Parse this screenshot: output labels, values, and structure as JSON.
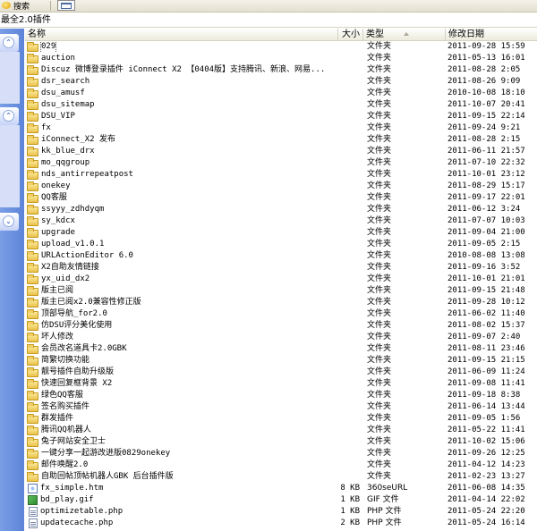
{
  "toolbar": {
    "search_label": "搜索",
    "view_icon": "view-grid-icon"
  },
  "address": {
    "path": "最全2.0插件"
  },
  "columns": {
    "name": "名称",
    "size": "大小",
    "type": "类型",
    "date": "修改日期"
  },
  "files": [
    {
      "name": "029",
      "size": "",
      "type": "文件夹",
      "date": "2011-09-28 15:59",
      "icon": "folder-icon"
    },
    {
      "name": "auction",
      "size": "",
      "type": "文件夹",
      "date": "2011-05-13 16:01",
      "icon": "folder-icon"
    },
    {
      "name": "Discuz 微博登录插件 iConnect X2 【0404版】支持腾讯、新浪、网易...",
      "size": "",
      "type": "文件夹",
      "date": "2011-08-28 2:05",
      "icon": "folder-icon"
    },
    {
      "name": "dsr_search",
      "size": "",
      "type": "文件夹",
      "date": "2011-08-26 9:09",
      "icon": "folder-icon"
    },
    {
      "name": "dsu_amusf",
      "size": "",
      "type": "文件夹",
      "date": "2010-10-08 18:10",
      "icon": "folder-icon"
    },
    {
      "name": "dsu_sitemap",
      "size": "",
      "type": "文件夹",
      "date": "2011-10-07 20:41",
      "icon": "folder-icon"
    },
    {
      "name": "DSU_VIP",
      "size": "",
      "type": "文件夹",
      "date": "2011-09-15 22:14",
      "icon": "folder-icon"
    },
    {
      "name": "fx",
      "size": "",
      "type": "文件夹",
      "date": "2011-09-24 9:21",
      "icon": "folder-icon"
    },
    {
      "name": "iConnect_X2 发布",
      "size": "",
      "type": "文件夹",
      "date": "2011-08-28 2:15",
      "icon": "folder-icon"
    },
    {
      "name": "kk_blue_drx",
      "size": "",
      "type": "文件夹",
      "date": "2011-06-11 21:57",
      "icon": "folder-icon"
    },
    {
      "name": "mo_qqgroup",
      "size": "",
      "type": "文件夹",
      "date": "2011-07-10 22:32",
      "icon": "folder-icon"
    },
    {
      "name": "nds_antirrepeatpost",
      "size": "",
      "type": "文件夹",
      "date": "2011-10-01 23:12",
      "icon": "folder-icon"
    },
    {
      "name": "onekey",
      "size": "",
      "type": "文件夹",
      "date": "2011-08-29 15:17",
      "icon": "folder-icon"
    },
    {
      "name": "QQ客服",
      "size": "",
      "type": "文件夹",
      "date": "2011-09-17 22:01",
      "icon": "folder-icon"
    },
    {
      "name": "ssyyy_zdhdyqm",
      "size": "",
      "type": "文件夹",
      "date": "2011-06-12 3:24",
      "icon": "folder-icon"
    },
    {
      "name": "sy_kdcx",
      "size": "",
      "type": "文件夹",
      "date": "2011-07-07 10:03",
      "icon": "folder-icon"
    },
    {
      "name": "upgrade",
      "size": "",
      "type": "文件夹",
      "date": "2011-09-04 21:00",
      "icon": "folder-icon"
    },
    {
      "name": "upload_v1.0.1",
      "size": "",
      "type": "文件夹",
      "date": "2011-09-05 2:15",
      "icon": "folder-icon"
    },
    {
      "name": "URLActionEditor 6.0",
      "size": "",
      "type": "文件夹",
      "date": "2010-08-08 13:08",
      "icon": "folder-icon"
    },
    {
      "name": "X2自助友情链接",
      "size": "",
      "type": "文件夹",
      "date": "2011-09-16 3:52",
      "icon": "folder-icon"
    },
    {
      "name": "yx_uid_dx2",
      "size": "",
      "type": "文件夹",
      "date": "2011-10-01 21:01",
      "icon": "folder-icon"
    },
    {
      "name": "版主已阅",
      "size": "",
      "type": "文件夹",
      "date": "2011-09-15 21:48",
      "icon": "folder-icon"
    },
    {
      "name": "版主已阅x2.0兼容性修正版",
      "size": "",
      "type": "文件夹",
      "date": "2011-09-28 10:12",
      "icon": "folder-icon"
    },
    {
      "name": "顶部导航_for2.0",
      "size": "",
      "type": "文件夹",
      "date": "2011-06-02 11:40",
      "icon": "folder-icon"
    },
    {
      "name": "仿DSU评分美化使用",
      "size": "",
      "type": "文件夹",
      "date": "2011-08-02 15:37",
      "icon": "folder-icon"
    },
    {
      "name": "坏人修改",
      "size": "",
      "type": "文件夹",
      "date": "2011-09-07 2:40",
      "icon": "folder-icon"
    },
    {
      "name": "会员改名道具卡2.0GBK",
      "size": "",
      "type": "文件夹",
      "date": "2011-08-11 23:46",
      "icon": "folder-icon"
    },
    {
      "name": "简繁切换功能",
      "size": "",
      "type": "文件夹",
      "date": "2011-09-15 21:15",
      "icon": "folder-icon"
    },
    {
      "name": "靓号插件自助升级版",
      "size": "",
      "type": "文件夹",
      "date": "2011-06-09 11:24",
      "icon": "folder-icon"
    },
    {
      "name": "快速回复框背景 X2",
      "size": "",
      "type": "文件夹",
      "date": "2011-09-08 11:41",
      "icon": "folder-icon"
    },
    {
      "name": "绿色QQ客服",
      "size": "",
      "type": "文件夹",
      "date": "2011-09-18 8:38",
      "icon": "folder-icon"
    },
    {
      "name": "签名购买插件",
      "size": "",
      "type": "文件夹",
      "date": "2011-06-14 13:44",
      "icon": "folder-icon"
    },
    {
      "name": "群发插件",
      "size": "",
      "type": "文件夹",
      "date": "2011-09-05 1:56",
      "icon": "folder-icon"
    },
    {
      "name": "腾讯QQ机器人",
      "size": "",
      "type": "文件夹",
      "date": "2011-05-22 11:41",
      "icon": "folder-icon"
    },
    {
      "name": "兔子网站安全卫士",
      "size": "",
      "type": "文件夹",
      "date": "2011-10-02 15:06",
      "icon": "folder-icon"
    },
    {
      "name": "一键分享一起游改进版0829onekey",
      "size": "",
      "type": "文件夹",
      "date": "2011-09-26 12:25",
      "icon": "folder-icon"
    },
    {
      "name": "邮件唤醒2.0",
      "size": "",
      "type": "文件夹",
      "date": "2011-04-12 14:23",
      "icon": "folder-icon"
    },
    {
      "name": "自助回帖顶帖机器人GBK 后台插件版",
      "size": "",
      "type": "文件夹",
      "date": "2011-02-23 13:27",
      "icon": "folder-icon"
    },
    {
      "name": "fx_simple.htm",
      "size": "8 KB",
      "type": "360seURL",
      "date": "2011-06-08 14:35",
      "icon": "html-file-icon"
    },
    {
      "name": "bd_play.gif",
      "size": "1 KB",
      "type": "GIF 文件",
      "date": "2011-04-14 22:02",
      "icon": "gif-file-icon"
    },
    {
      "name": "optimizetable.php",
      "size": "1 KB",
      "type": "PHP 文件",
      "date": "2011-05-24 22:20",
      "icon": "php-file-icon"
    },
    {
      "name": "updatecache.php",
      "size": "2 KB",
      "type": "PHP 文件",
      "date": "2011-05-24 16:14",
      "icon": "php-file-icon"
    }
  ]
}
